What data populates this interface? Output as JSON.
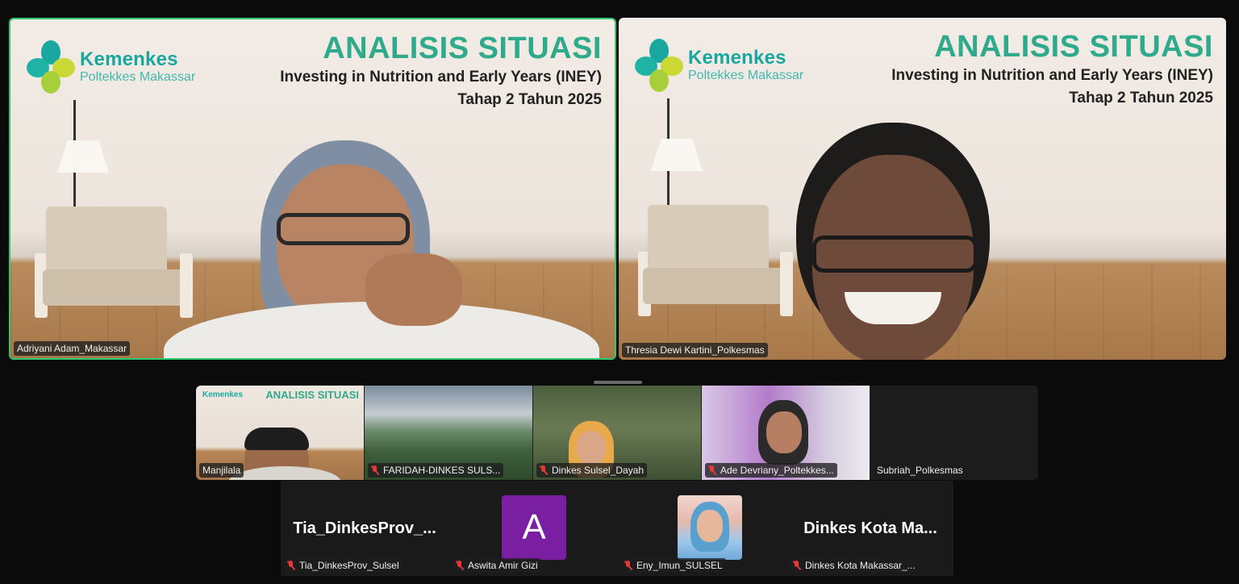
{
  "banner": {
    "logo_name": "Kemenkes",
    "logo_sub": "Poltekkes Makassar",
    "title": "ANALISIS SITUASI",
    "subtitle_line1": "Investing in Nutrition and Early Years (INEY)",
    "subtitle_line2": "Tahap 2 Tahun 2025"
  },
  "main_tiles": [
    {
      "name": "Adriyani Adam_Makassar",
      "active_speaker": true
    },
    {
      "name": "Thresia Dewi Kartini_Polkesmas",
      "active_speaker": false
    }
  ],
  "strip": [
    {
      "name": "Manjilala",
      "muted": false
    },
    {
      "name": "FARIDAH-DINKES SULS...",
      "muted": true
    },
    {
      "name": "Dinkes Sulsel_Dayah",
      "muted": true
    },
    {
      "name": "Ade Devriany_Poltekkes...",
      "muted": true
    },
    {
      "name": "Subriah_Polkesmas",
      "muted": false
    }
  ],
  "grid": [
    {
      "display": "Tia_DinkesProv_...",
      "name": "Tia_DinkesProv_Sulsel",
      "muted": true
    },
    {
      "avatar_letter": "A",
      "name": "Aswita Amir Gizi",
      "muted": true
    },
    {
      "name": "Eny_Imun_SULSEL",
      "muted": true
    },
    {
      "display": "Dinkes Kota Ma...",
      "name": "Dinkes Kota Makassar_...",
      "muted": true
    }
  ],
  "colors": {
    "active_border": "#2ecc71",
    "title_green": "#2faa8c",
    "logo_teal": "#19a7a0",
    "muted_red": "#e53935",
    "avatar_purple": "#7b1fa2"
  }
}
